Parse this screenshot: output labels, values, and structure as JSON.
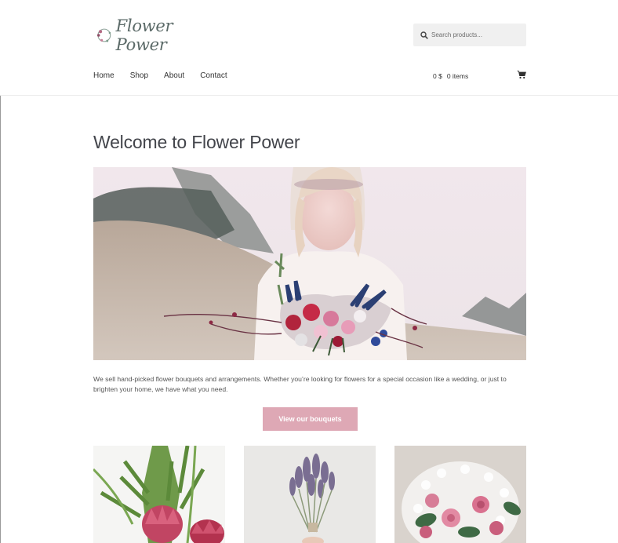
{
  "site": {
    "logo_text": "Flower Power"
  },
  "search": {
    "placeholder": "Search products..."
  },
  "nav": {
    "items": [
      "Home",
      "Shop",
      "About",
      "Contact"
    ]
  },
  "cart": {
    "amount": "0 $",
    "items": "0 items"
  },
  "page": {
    "title": "Welcome to Flower Power",
    "intro": "We sell hand-picked flower bouquets and arrangements. Whether you’re looking for flowers for a special occasion like a wedding, or just to brighten your home, we have what you need.",
    "cta_label": "View our bouquets"
  },
  "colors": {
    "accent": "#dea8b5",
    "text": "#43454b",
    "logo": "#5b6a68"
  },
  "icons": {
    "search": "search-icon",
    "cart": "cart-icon"
  }
}
